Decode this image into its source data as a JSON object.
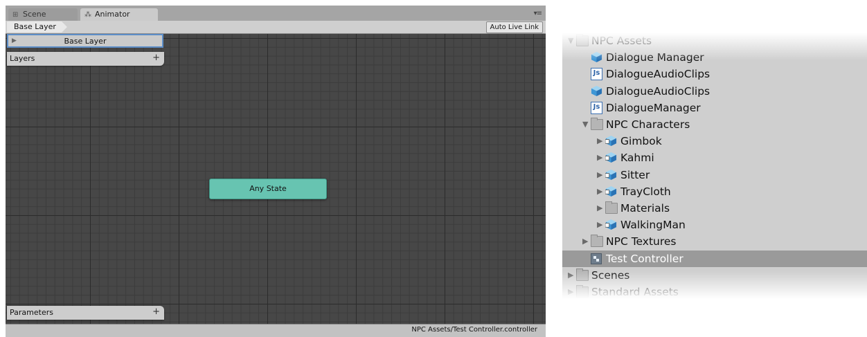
{
  "animator": {
    "tabs": [
      {
        "label": "Scene",
        "icon": "grid-icon"
      },
      {
        "label": "Animator",
        "icon": "animator-icon"
      }
    ],
    "breadcrumb": "Base Layer",
    "auto_live_link": "Auto Live Link",
    "layer_name": "Base Layer",
    "layers_label": "Layers",
    "parameters_label": "Parameters",
    "add_symbol": "+",
    "any_state": "Any State",
    "status_path": "NPC Assets/Test Controller.controller",
    "colors": {
      "state_fill": "#67c4b1",
      "grid_bg": "#474747",
      "selection_border": "#5d8ec8"
    }
  },
  "project": {
    "items": [
      {
        "label": "NPC Assets",
        "icon": "folder-icon",
        "expanded": true
      },
      {
        "label": "Dialogue Manager",
        "icon": "prefab-cube-icon"
      },
      {
        "label": "DialogueAudioClips",
        "icon": "js-script-icon"
      },
      {
        "label": "DialogueAudioClips",
        "icon": "prefab-cube-icon"
      },
      {
        "label": "DialogueManager",
        "icon": "js-script-icon"
      },
      {
        "label": "NPC Characters",
        "icon": "folder-icon",
        "expanded": true
      },
      {
        "label": "Gimbok",
        "icon": "model-icon",
        "expanded": false
      },
      {
        "label": "Kahmi",
        "icon": "model-icon",
        "expanded": false
      },
      {
        "label": "Sitter",
        "icon": "model-icon",
        "expanded": false
      },
      {
        "label": "TrayCloth",
        "icon": "model-icon",
        "expanded": false
      },
      {
        "label": "Materials",
        "icon": "folder-icon",
        "expanded": false
      },
      {
        "label": "WalkingMan",
        "icon": "model-icon",
        "expanded": false
      },
      {
        "label": "NPC Textures",
        "icon": "folder-icon",
        "expanded": false
      },
      {
        "label": "Test Controller",
        "icon": "animator-controller-icon",
        "selected": true
      },
      {
        "label": "Scenes",
        "icon": "folder-icon",
        "expanded": false
      },
      {
        "label": "Standard Assets",
        "icon": "folder-icon",
        "expanded": false
      }
    ],
    "js_glyph": "Js"
  }
}
